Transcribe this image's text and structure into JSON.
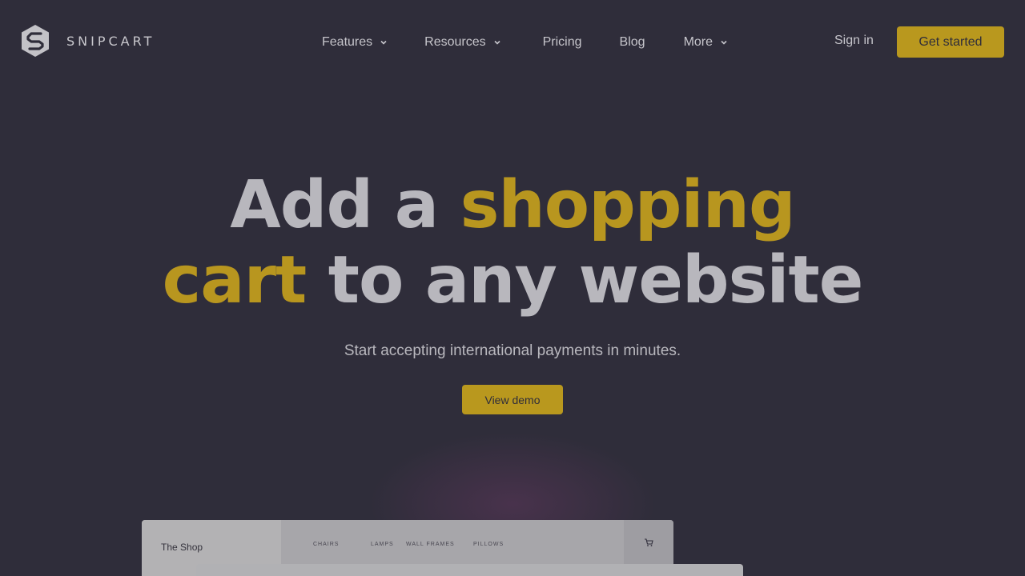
{
  "brand": {
    "name": "SNIPCART",
    "logo_icon": "snipcart-hexagon-s-icon"
  },
  "nav": {
    "items": [
      {
        "label": "Features",
        "has_dropdown": true
      },
      {
        "label": "Resources",
        "has_dropdown": true
      },
      {
        "label": "Pricing",
        "has_dropdown": false
      },
      {
        "label": "Blog",
        "has_dropdown": false
      },
      {
        "label": "More",
        "has_dropdown": true
      }
    ],
    "signin": "Sign in",
    "cta": "Get started"
  },
  "hero": {
    "title_part1": "Add a ",
    "title_accent1": "shopping",
    "title_accent2": "cart",
    "title_part2": " to any website",
    "subtitle": "Start accepting international payments in minutes.",
    "demo_button": "View demo"
  },
  "mockup": {
    "shop_name": "The Shop",
    "nav": [
      "CHAIRS",
      "LAMPS",
      "WALL FRAMES",
      "PILLOWS"
    ],
    "cart_icon": "cart-icon"
  },
  "colors": {
    "background": "#2f2d3a",
    "accent": "#b9981e",
    "text": "#c9c8cd"
  }
}
